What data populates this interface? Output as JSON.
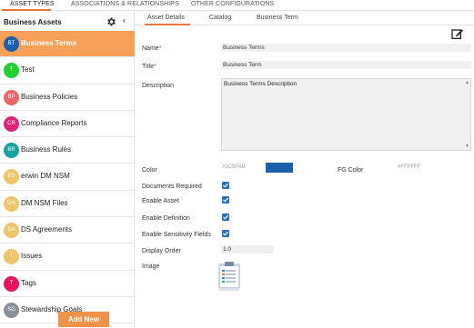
{
  "top_tabs": [
    "ASSET TYPES",
    "ASSOCIATIONS & RELATIONSHIPS",
    "OTHER CONFIGURATIONS"
  ],
  "sidebar": {
    "title": "Business Assets",
    "items": [
      {
        "initials": "BT",
        "label": "Business Terms",
        "color": "#1c5fab",
        "active": true
      },
      {
        "initials": "T",
        "label": "Test",
        "color": "#22d12e",
        "active": false
      },
      {
        "initials": "BP",
        "label": "Business Policies",
        "color": "#e8676c",
        "active": false
      },
      {
        "initials": "CR",
        "label": "Compliance Reports",
        "color": "#e0247a",
        "active": false
      },
      {
        "initials": "BR",
        "label": "Business Rules",
        "color": "#16a3a0",
        "active": false
      },
      {
        "initials": "ED",
        "label": "erwin DM NSM",
        "color": "#f0c469",
        "active": false
      },
      {
        "initials": "DN",
        "label": "DM NSM Files",
        "color": "#f0c469",
        "active": false
      },
      {
        "initials": "DA",
        "label": "DS Agreements",
        "color": "#f0c469",
        "active": false
      },
      {
        "initials": "I",
        "label": "Issues",
        "color": "#f0c469",
        "active": false
      },
      {
        "initials": "T",
        "label": "Tags",
        "color": "#e8135c",
        "active": false
      },
      {
        "initials": "SG",
        "label": "Stewardship Goals",
        "color": "#8a8f9a",
        "active": false
      }
    ],
    "add_new": "Add New"
  },
  "sub_tabs": [
    "Asset Details",
    "Catalog",
    "Business Term"
  ],
  "form": {
    "name_label": "Name",
    "name_value": "Business Terms",
    "title_label": "Title",
    "title_value": "Business Term",
    "description_label": "Description",
    "description_value": "Business Terms Description",
    "color_label": "Color",
    "color_value": "#1C5FAB",
    "fg_color_label": "FG Color",
    "fg_color_value": "#FFFFFF",
    "documents_required_label": "Documents Required",
    "enable_asset_label": "Enable Asset",
    "enable_definition_label": "Enable Definition",
    "enable_sensitivity_label": "Enable Sensitivity Fields",
    "display_order_label": "Display Order",
    "display_order_value": "1.0",
    "image_label": "Image",
    "documents_required": true,
    "enable_asset": true,
    "enable_definition": true,
    "enable_sensitivity": true
  },
  "accent_color": "#f7a05a",
  "swatch_color": "#1c5fab",
  "check_color": "#2d6fb8"
}
